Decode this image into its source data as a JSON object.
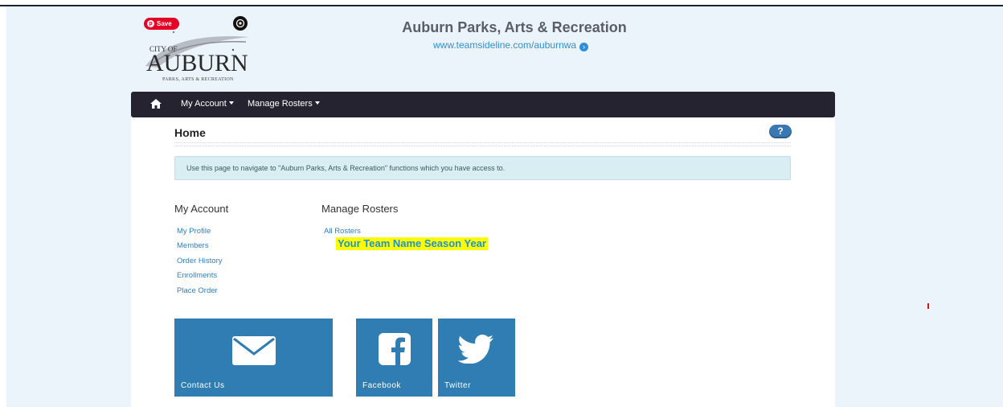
{
  "browser": {
    "save_button": "Save"
  },
  "logo": {
    "line1": "CITY OF",
    "name": "AUBURN",
    "tagline": "PARKS, ARTS & RECREATION"
  },
  "header": {
    "title": "Auburn Parks, Arts & Recreation",
    "url": "www.teamsideline.com/auburnwa"
  },
  "nav": {
    "items": [
      {
        "label": "My Account"
      },
      {
        "label": "Manage Rosters"
      }
    ]
  },
  "page": {
    "title": "Home",
    "help_label": "?",
    "info": "Use this page to navigate to \"Auburn Parks, Arts & Recreation\" functions which you have access to."
  },
  "my_account": {
    "heading": "My Account",
    "links": [
      "My Profile",
      "Members",
      "Order History",
      "Enrollments",
      "Place Order"
    ]
  },
  "manage_rosters": {
    "heading": "Manage Rosters",
    "links": [
      "All Rosters"
    ],
    "highlight": "Your Team Name  Season  Year"
  },
  "tiles": [
    {
      "label": "Contact Us",
      "icon": "envelope-icon"
    },
    {
      "label": "Facebook",
      "icon": "facebook-icon"
    },
    {
      "label": "Twitter",
      "icon": "twitter-icon"
    }
  ],
  "colors": {
    "nav_bg": "#24232f",
    "tile_bg": "#2f7db3",
    "link": "#2f7fc8",
    "info_bg": "#d9eef3",
    "highlight": "#ffff00"
  }
}
